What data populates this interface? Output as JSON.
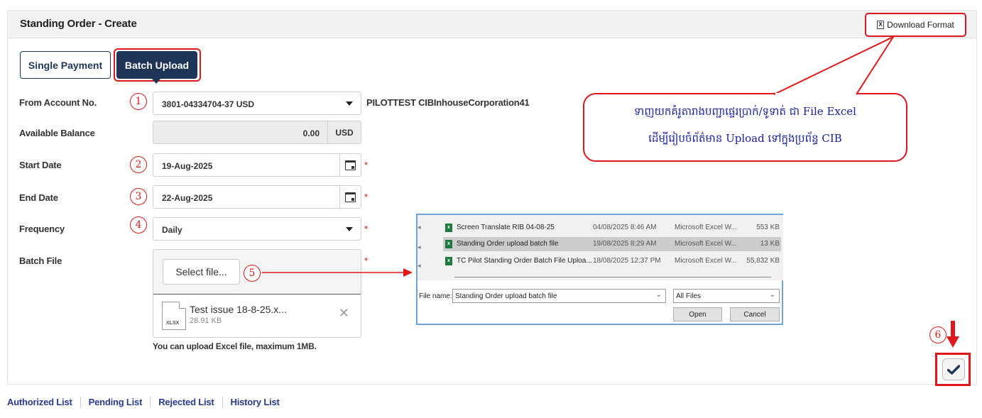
{
  "panel": {
    "title": "Standing Order - Create",
    "download_label": "Download Format"
  },
  "tabs": [
    {
      "label": "Single Payment"
    },
    {
      "label": "Batch Upload"
    }
  ],
  "form": {
    "from_account": {
      "label": "From Account No.",
      "step": "1",
      "value": "3801-04334704-37 USD",
      "account_name": "PILOTTEST CIBInhouseCorporation41"
    },
    "balance": {
      "label": "Available Balance",
      "amount": "0.00",
      "currency": "USD"
    },
    "start_date": {
      "label": "Start Date",
      "step": "2",
      "value": "19-Aug-2025"
    },
    "end_date": {
      "label": "End Date",
      "step": "3",
      "value": "22-Aug-2025"
    },
    "frequency": {
      "label": "Frequency",
      "step": "4",
      "value": "Daily"
    },
    "batch_file": {
      "label": "Batch File",
      "step": "5",
      "select_label": "Select file...",
      "file_name": "Test issue 18-8-25.x...",
      "file_size": "28.91 KB",
      "file_ext": "XLSX",
      "hint": "You can upload Excel file, maximum 1MB."
    },
    "required_mark": "*"
  },
  "dialog": {
    "files": [
      {
        "name": "Screen Translate RIB 04-08-25",
        "date": "04/08/2025 8:46 AM",
        "type": "Microsoft Excel W...",
        "size": "553 KB",
        "selected": false
      },
      {
        "name": "Standing Order upload batch  file",
        "date": "19/08/2025 8:29 AM",
        "type": "Microsoft Excel W...",
        "size": "13 KB",
        "selected": true
      },
      {
        "name": "TC Pilot Standing Order Batch File Uploa...",
        "date": "18/08/2025 12:37 PM",
        "type": "Microsoft Excel W...",
        "size": "55,832 KB",
        "selected": false
      }
    ],
    "file_name_label": "File name:",
    "file_name_value": "Standing Order upload batch  file",
    "file_type": "All Files",
    "open_label": "Open",
    "cancel_label": "Cancel"
  },
  "callout": {
    "line1": "ទាញយកគំរូតារាងបញ្ជាផ្ទេរប្រាក់/ទូទាត់ ជា File Excel",
    "line2": "ដើម្បីរៀបចំព័ត៌មាន Upload ទៅក្នុងប្រព័ន្ធ CIB"
  },
  "submit": {
    "step": "6",
    "icon": "check-icon"
  },
  "bottom_links": [
    "Authorized List",
    "Pending List",
    "Rejected List",
    "History List"
  ],
  "colors": {
    "navy": "#1e3557",
    "annotation_red": "#e0181b",
    "link_blue": "#2a3a8c",
    "callout_text": "#1a22a0"
  }
}
